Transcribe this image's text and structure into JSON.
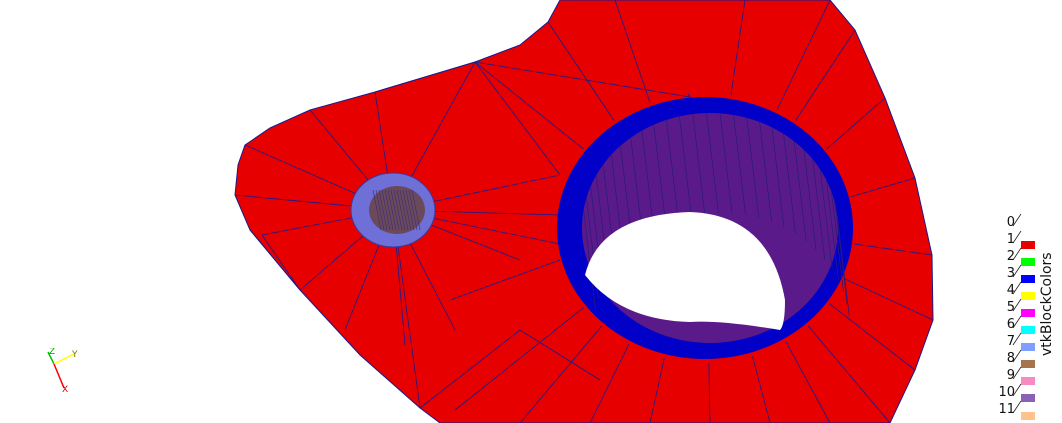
{
  "legend": {
    "title": "vtkBlockColors",
    "entries": [
      {
        "label": "0",
        "color": null
      },
      {
        "label": "1",
        "color": null
      },
      {
        "label": "2",
        "color": "#e60000"
      },
      {
        "label": "3",
        "color": "#00ff00"
      },
      {
        "label": "4",
        "color": "#0000ff"
      },
      {
        "label": "5",
        "color": "#ffff00"
      },
      {
        "label": "6",
        "color": "#ff00ff"
      },
      {
        "label": "7",
        "color": "#00ffff"
      },
      {
        "label": "8",
        "color": "#7f9fff"
      },
      {
        "label": "9",
        "color": "#a6744c"
      },
      {
        "label": "10",
        "color": "#f78bbf"
      },
      {
        "label": "11",
        "color": "#8a62b5"
      }
    ],
    "extra_swatch_color": "#ffc28c"
  },
  "axes": {
    "x_label": "X",
    "y_label": "Y",
    "z_label": "Z",
    "x_color": "#ff0000",
    "y_color": "#ffff00",
    "z_color": "#00c000"
  },
  "scene": {
    "surface_color": "#e60000",
    "edge_color": "#1a1a8c",
    "hole_rim_color": "#0000c8",
    "hole_inner_color": "#5a1a8a",
    "small_hole_color": "#6f6fd8",
    "green_part_color": "#0a6e0a",
    "background": "#ffffff"
  }
}
